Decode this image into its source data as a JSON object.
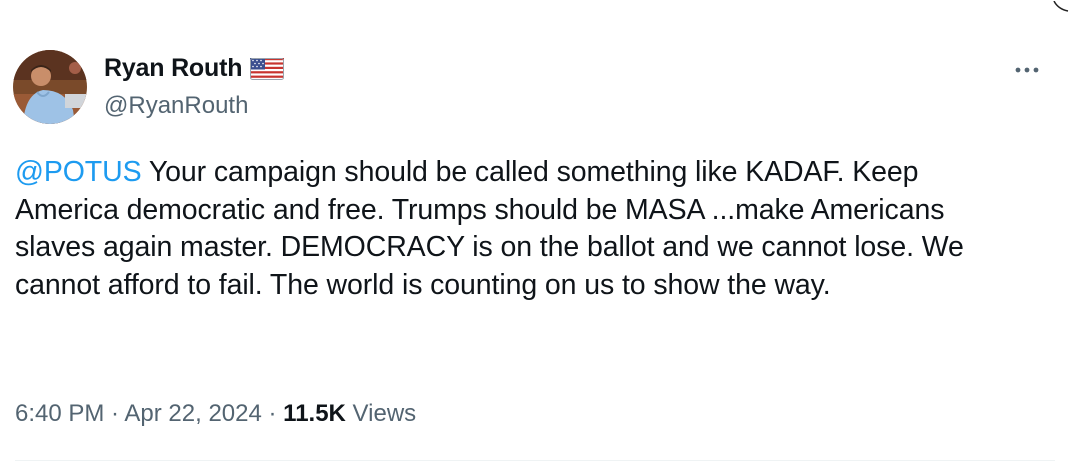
{
  "author": {
    "display_name": "Ryan Routh",
    "handle": "@RyanRouth",
    "badge_icon": "us-flag-icon"
  },
  "more_icon": "more-options-icon",
  "tweet": {
    "mention": "@POTUS",
    "text": " Your campaign should be called something like KADAF. Keep America democratic and free. Trumps should be MASA ...make Americans slaves again master. DEMOCRACY is on the ballot and we cannot lose. We cannot afford to fail. The world is counting on us to show the way."
  },
  "meta": {
    "time": "6:40 PM",
    "separator1": " · ",
    "date": "Apr 22, 2024",
    "separator2": " · ",
    "views_count": "11.5K",
    "views_label": " Views"
  },
  "colors": {
    "link": "#1d9bf0",
    "text": "#0f1419",
    "secondary": "#536471"
  }
}
